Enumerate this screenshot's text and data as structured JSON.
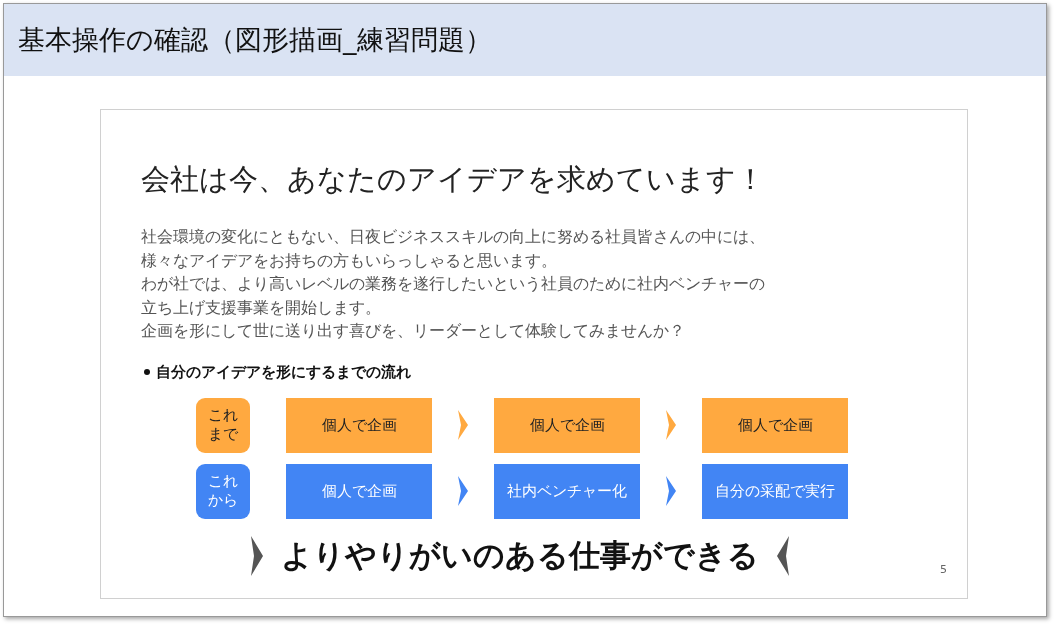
{
  "header": {
    "title": "基本操作の確認（図形描画_練習問題）"
  },
  "slide": {
    "title": "会社は今、あなたのアイデアを求めています！",
    "paragraphs": [
      "社会環境の変化にともない、日夜ビジネススキルの向上に努める社員皆さんの中には、",
      "様々なアイデアをお持ちの方もいらっしゃると思います。",
      "わが社では、より高いレベルの業務を遂行したいという社員のために社内ベンチャーの",
      "立ち上げ支援事業を開始します。",
      "企画を形にして世に送り出す喜びを、リーダーとして体験してみませんか？"
    ],
    "bullet_heading": "自分のアイデアを形にするまでの流れ",
    "flow_rows": [
      {
        "label": [
          "これ",
          "まで"
        ],
        "color": "#ffa940",
        "kind": "light",
        "steps": [
          "個人で企画",
          "個人で企画",
          "個人で企画"
        ]
      },
      {
        "label": [
          "これ",
          "から"
        ],
        "color": "#4285f4",
        "kind": "dark",
        "steps": [
          "個人で企画",
          "社内ベンチャー化",
          "自分の采配で実行"
        ]
      }
    ],
    "conclusion": "よりやりがいのある仕事ができる",
    "page_number": "5"
  }
}
